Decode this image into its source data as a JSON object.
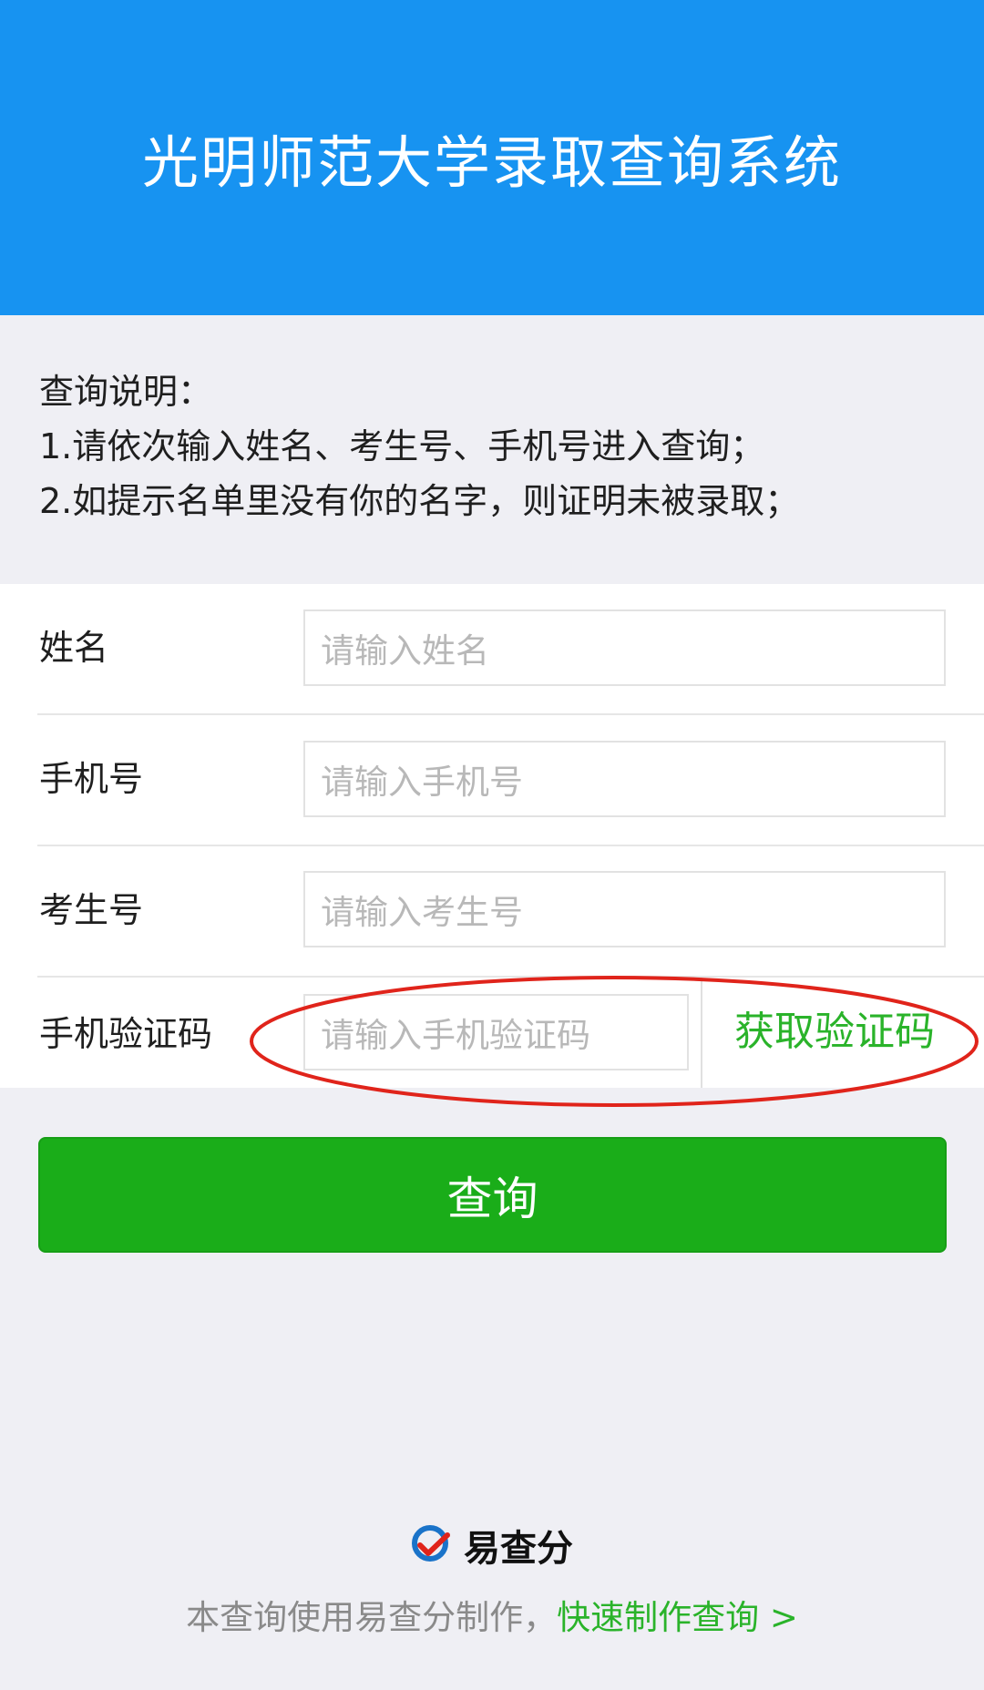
{
  "header": {
    "title": "光明师范大学录取查询系统"
  },
  "notes": {
    "heading": "查询说明：",
    "lines": [
      "1.请依次输入姓名、考生号、手机号进入查询；",
      "2.如提示名单里没有你的名字，则证明未被录取；"
    ]
  },
  "form": {
    "fields": [
      {
        "label": "姓名",
        "placeholder": "请输入姓名"
      },
      {
        "label": "手机号",
        "placeholder": "请输入手机号"
      },
      {
        "label": "考生号",
        "placeholder": "请输入考生号"
      },
      {
        "label": "手机验证码",
        "placeholder": "请输入手机验证码"
      }
    ],
    "get_code_label": "获取验证码"
  },
  "query_button": {
    "label": "查询"
  },
  "brand": {
    "name": "易查分",
    "logo_icon": "yichafen-logo-icon"
  },
  "footer": {
    "text": "本查询使用易查分制作，",
    "link": "快速制作查询 >"
  },
  "colors": {
    "header_bg": "#1793f1",
    "button_green": "#1aad19",
    "link_green": "#2ab32a",
    "annotation_red": "#e0241b"
  }
}
